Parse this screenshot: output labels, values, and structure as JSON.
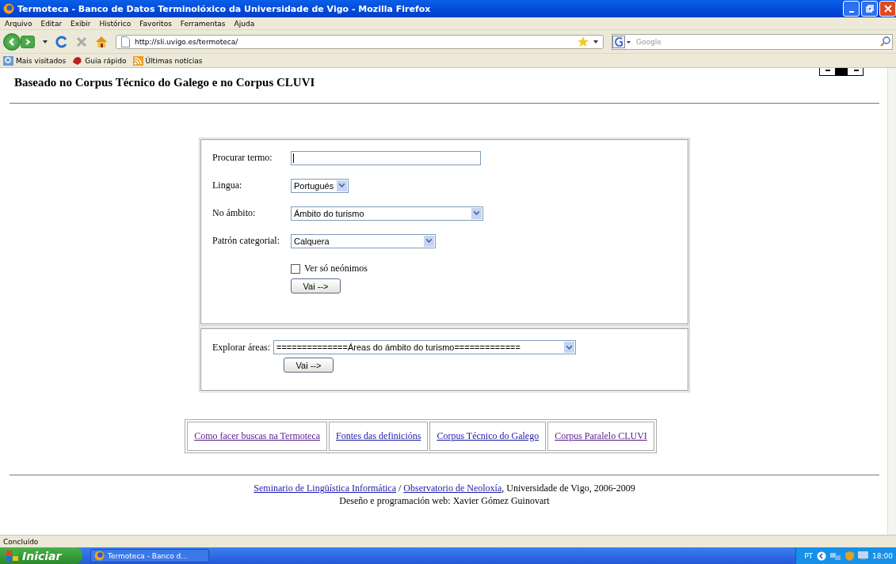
{
  "window": {
    "title": "Termoteca - Banco de Datos Terminolóxico da Universidade de Vigo - Mozilla Firefox"
  },
  "menu": [
    "Arquivo",
    "Editar",
    "Exibir",
    "Histórico",
    "Favoritos",
    "Ferramentas",
    "Ajuda"
  ],
  "address_bar": {
    "value": "http://sli.uvigo.es/termoteca/"
  },
  "search_box": {
    "placeholder": "Google"
  },
  "bookmarks": [
    "Mais visitados",
    "Guia rápido",
    "Últimas notícias"
  ],
  "page": {
    "heading": "Baseado no Corpus Técnico do Galego e no Corpus CLUVI",
    "search_form": {
      "term_label": "Procurar termo:",
      "language_label": "Lingua:",
      "language_value": "Portugués",
      "scope_label": "No ámbito:",
      "scope_value": "Ámbito do turismo",
      "pattern_label": "Patrón categorial:",
      "pattern_value": "Calquera",
      "neonyms": {
        "label": "Ver só neónimos",
        "checked": false
      },
      "submit": "Vai -->"
    },
    "explore_form": {
      "label": "Explorar áreas:",
      "value": "==============Áreas do ámbito do turismo=============",
      "submit": "Vai -->"
    },
    "links": [
      {
        "label": "Como facer buscas na Termoteca",
        "visited": true
      },
      {
        "label": "Fontes das definicións",
        "visited": false
      },
      {
        "label": "Corpus Técnico do Galego",
        "visited": false
      },
      {
        "label": "Corpus Paralelo CLUVI",
        "visited": true
      }
    ],
    "footer": {
      "link_1": "Seminario de Lingüística Informática",
      "separator": "/",
      "link_2": "Observatorio de Neoloxía",
      "rest": ", Universidade de Vigo, 2006-2009",
      "credit": "Deseño e programación web: Xavier Gómez Guinovart"
    }
  },
  "status_bar": "Concluído",
  "taskbar": {
    "start": "Iniciar",
    "task": "Termoteca - Banco d...",
    "language": "PT",
    "clock": "18:00"
  }
}
